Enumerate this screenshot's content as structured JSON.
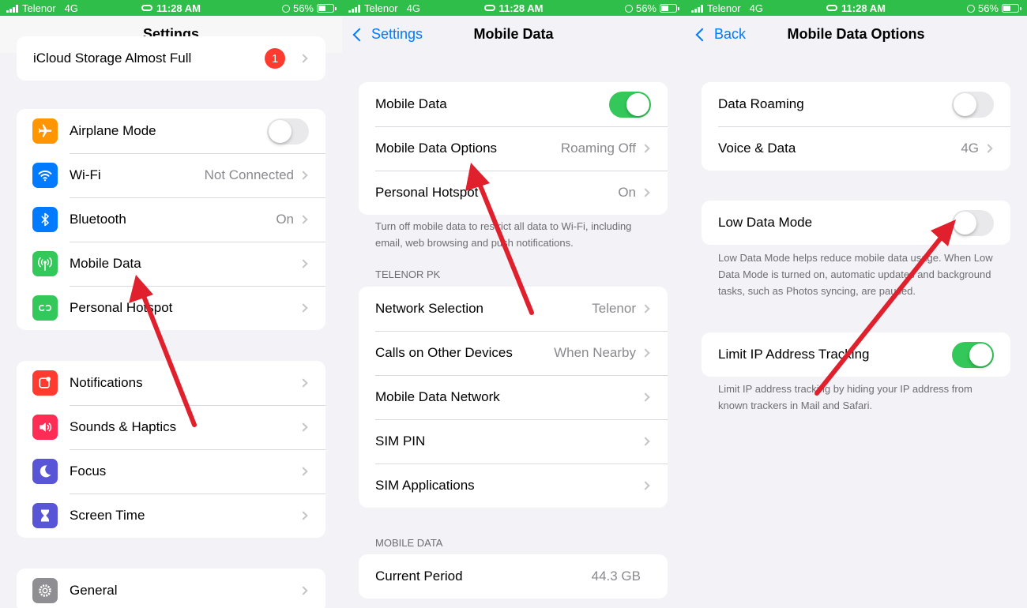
{
  "status_bar": {
    "carrier": "Telenor",
    "network": "4G",
    "time": "11:28 AM",
    "battery": "56%",
    "battery_level": 0.56
  },
  "colors": {
    "accent": "#007aff",
    "toggle_on": "#34c759",
    "status_bar": "#2fbe4a",
    "badge": "#ff3b30",
    "annotation_arrow": "#e0202c"
  },
  "screen1": {
    "title": "Settings",
    "icloud": {
      "label": "iCloud Storage Almost Full",
      "badge": "1"
    },
    "group1": [
      {
        "label": "Airplane Mode",
        "icon": "airplane-icon",
        "icon_color": "#ff9500",
        "toggle": false
      },
      {
        "label": "Wi-Fi",
        "icon": "wifi-icon",
        "icon_color": "#007aff",
        "value": "Not Connected"
      },
      {
        "label": "Bluetooth",
        "icon": "bluetooth-icon",
        "icon_color": "#007aff",
        "value": "On"
      },
      {
        "label": "Mobile Data",
        "icon": "antenna-icon",
        "icon_color": "#34c759"
      },
      {
        "label": "Personal Hotspot",
        "icon": "hotspot-icon",
        "icon_color": "#34c759"
      }
    ],
    "group2": [
      {
        "label": "Notifications",
        "icon": "bell-icon",
        "icon_color": "#ff3b30"
      },
      {
        "label": "Sounds & Haptics",
        "icon": "speaker-icon",
        "icon_color": "#ff2d55"
      },
      {
        "label": "Focus",
        "icon": "moon-icon",
        "icon_color": "#5856d6"
      },
      {
        "label": "Screen Time",
        "icon": "hourglass-icon",
        "icon_color": "#5856d6"
      }
    ],
    "group3": [
      {
        "label": "General",
        "icon": "gear-icon",
        "icon_color": "#8e8e93"
      }
    ]
  },
  "screen2": {
    "back": "Settings",
    "title": "Mobile Data",
    "group1": [
      {
        "label": "Mobile Data",
        "toggle": true
      },
      {
        "label": "Mobile Data Options",
        "value": "Roaming Off"
      },
      {
        "label": "Personal Hotspot",
        "value": "On"
      }
    ],
    "footer1": "Turn off mobile data to restrict all data to Wi-Fi, including email, web browsing and push notifications.",
    "section_telenor": "TELENOR PK",
    "group2": [
      {
        "label": "Network Selection",
        "value": "Telenor"
      },
      {
        "label": "Calls on Other Devices",
        "value": "When Nearby"
      },
      {
        "label": "Mobile Data Network"
      },
      {
        "label": "SIM PIN"
      },
      {
        "label": "SIM Applications"
      }
    ],
    "section_mobile_data": "MOBILE DATA",
    "group3": [
      {
        "label": "Current Period",
        "value": "44.3 GB"
      }
    ]
  },
  "screen3": {
    "back": "Back",
    "title": "Mobile Data Options",
    "group1": [
      {
        "label": "Data Roaming",
        "toggle": false
      },
      {
        "label": "Voice & Data",
        "value": "4G"
      }
    ],
    "group2": [
      {
        "label": "Low Data Mode",
        "toggle": false
      }
    ],
    "footer2": "Low Data Mode helps reduce mobile data usage. When Low Data Mode is turned on, automatic updates and background tasks, such as Photos syncing, are paused.",
    "group3": [
      {
        "label": "Limit IP Address Tracking",
        "toggle": true
      }
    ],
    "footer3": "Limit IP address tracking by hiding your IP address from known trackers in Mail and Safari."
  }
}
